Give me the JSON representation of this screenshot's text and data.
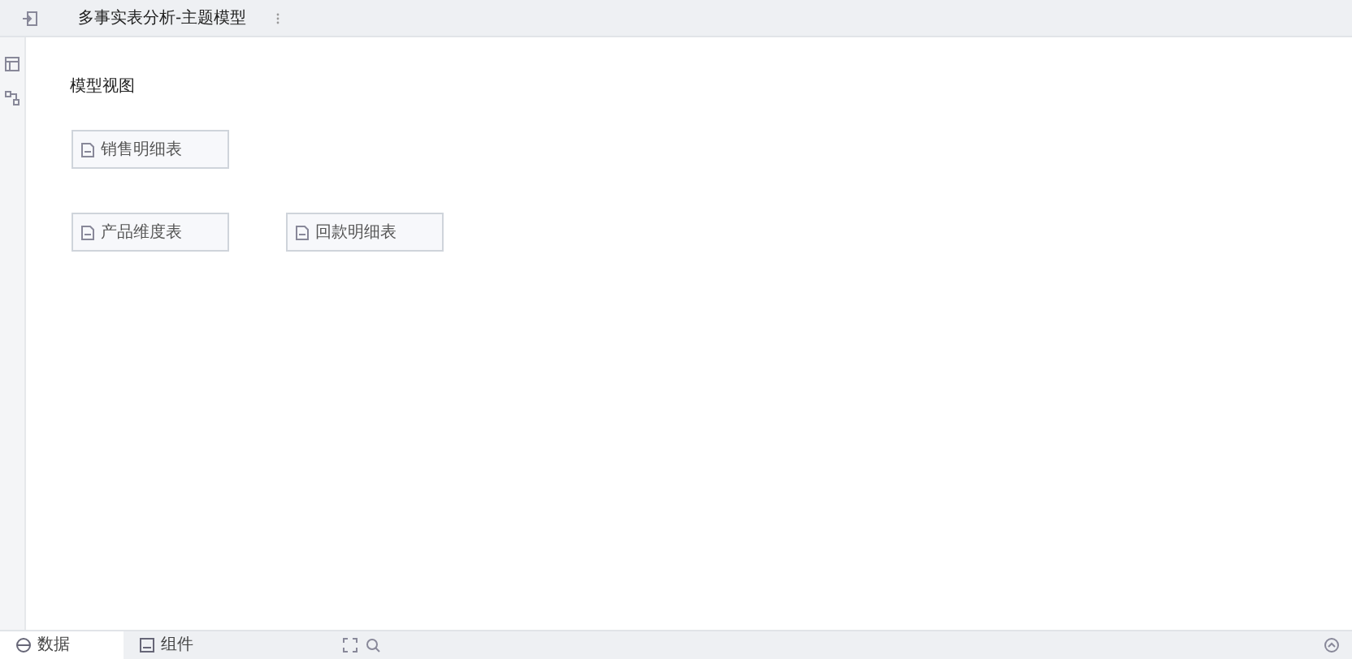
{
  "window": {
    "title": "多事实表分析-主题模型"
  },
  "canvas": {
    "title": "模型视图",
    "tables": [
      {
        "name": "销售明细表"
      },
      {
        "name": "产品维度表"
      },
      {
        "name": "回款明细表"
      }
    ]
  },
  "bottom_tabs": [
    {
      "label": "数据",
      "selected": true
    },
    {
      "label": "组件",
      "selected": false
    }
  ]
}
